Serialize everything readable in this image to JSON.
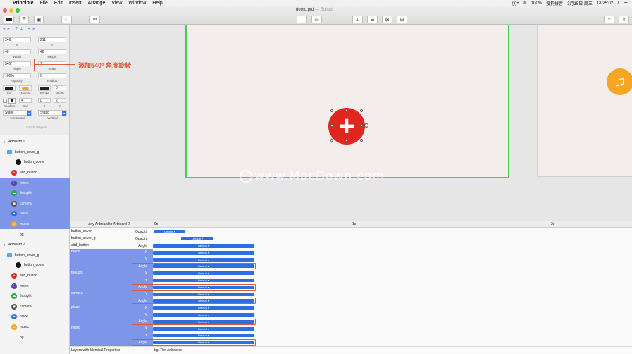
{
  "menubar": {
    "apple": "",
    "app_name": "Principle",
    "menus": [
      "File",
      "Edit",
      "Insert",
      "Arrange",
      "View",
      "Window",
      "Help"
    ],
    "status": {
      "battery": "100%",
      "input_method": "搜狗拼音",
      "date": "3月15日 周三",
      "time": "18:25:02",
      "extra": "gg+"
    }
  },
  "window": {
    "title": "demo.prd",
    "edited": "— Edited"
  },
  "toolbar": {
    "text_tool": "T"
  },
  "inspector": {
    "x": "246",
    "y": "211",
    "x_label": "X",
    "y_label": "Y",
    "width": "48",
    "height": "48",
    "width_label": "Width",
    "height_label": "Height",
    "angle": "540°",
    "scale": "1",
    "angle_label": "Angle",
    "scale_label": "Scale",
    "opacity": "100%",
    "radius": "0",
    "opacity_label": "Opacity",
    "radius_label": "Radius",
    "fill_label": "Fill",
    "media_label": "Media",
    "stroke_label": "Stroke",
    "stroke_width": "0",
    "stroke_width_label": "Width",
    "shadow_label": "Shadow",
    "blur": "4",
    "blur_label": "Blur",
    "shadow_x": "0",
    "shadow_y": "2",
    "shadow_x_label": "X",
    "shadow_y_label": "Y",
    "horizontal": "Static",
    "vertical": "Static",
    "horizontal_label": "Horizontal",
    "vertical_label": "Vertical",
    "clip_sublayers": "Clip Sublayers"
  },
  "annotation": {
    "text": "添加540° 角度旋转"
  },
  "layers": [
    {
      "label": "Artboard 1",
      "indent": 0,
      "icon": "disclosure",
      "hl": false
    },
    {
      "label": "button_cover_g",
      "indent": 1,
      "icon": "folder",
      "hl": false
    },
    {
      "label": "button_cover",
      "indent": 3,
      "icon": "black",
      "hl": false
    },
    {
      "label": "add_button",
      "indent": 2,
      "icon": "red",
      "hl": false
    },
    {
      "label": "moon",
      "indent": 2,
      "icon": "purple",
      "hl": true
    },
    {
      "label": "thought",
      "indent": 2,
      "icon": "green",
      "hl": true
    },
    {
      "label": "camera",
      "indent": 2,
      "icon": "gray",
      "hl": true
    },
    {
      "label": "place",
      "indent": 2,
      "icon": "blue",
      "hl": true
    },
    {
      "label": "music",
      "indent": 2,
      "icon": "orange",
      "hl": true
    },
    {
      "label": "bg",
      "indent": 2,
      "icon": "none",
      "hl": false
    },
    {
      "label": "Artboard 2",
      "indent": 0,
      "icon": "disclosure",
      "hl": false
    },
    {
      "label": "button_cover_g",
      "indent": 1,
      "icon": "folder",
      "hl": false
    },
    {
      "label": "button_cover",
      "indent": 3,
      "icon": "black",
      "hl": false
    },
    {
      "label": "add_button",
      "indent": 2,
      "icon": "red",
      "hl": false
    },
    {
      "label": "moon",
      "indent": 2,
      "icon": "purple",
      "hl": false
    },
    {
      "label": "thought",
      "indent": 2,
      "icon": "green",
      "hl": false
    },
    {
      "label": "camera",
      "indent": 2,
      "icon": "gray",
      "hl": false
    },
    {
      "label": "place",
      "indent": 2,
      "icon": "blue",
      "hl": false
    },
    {
      "label": "music",
      "indent": 2,
      "icon": "orange",
      "hl": false
    },
    {
      "label": "bg",
      "indent": 2,
      "icon": "none",
      "hl": false
    }
  ],
  "canvas": {
    "add_glyph": "+",
    "music_glyph": "♫",
    "watermark": "www.MacDown.com"
  },
  "timeline": {
    "transition": "Any Artboard to Artboard 2",
    "ticks": [
      "0s",
      "1s",
      "2s"
    ],
    "default_label": "Default ▾",
    "footer_label": "Layers with Identical Properties",
    "footer_value": "bg, The Artboards",
    "rows": [
      {
        "layer": "button_cover",
        "prop": "Opacity"
      },
      {
        "layer": "button_cover_g",
        "prop": "Opacity"
      },
      {
        "layer": "add_button",
        "prop": "Angle"
      },
      {
        "layer": "moon",
        "prop": "X"
      },
      {
        "layer": "",
        "prop": "Y"
      },
      {
        "layer": "",
        "prop": "Angle"
      },
      {
        "layer": "thought",
        "prop": "X"
      },
      {
        "layer": "",
        "prop": "Y"
      },
      {
        "layer": "",
        "prop": "Angle"
      },
      {
        "layer": "camera",
        "prop": "Y"
      },
      {
        "layer": "",
        "prop": "Angle"
      },
      {
        "layer": "place",
        "prop": "X"
      },
      {
        "layer": "",
        "prop": "Y"
      },
      {
        "layer": "",
        "prop": "Angle"
      },
      {
        "layer": "music",
        "prop": "X"
      },
      {
        "layer": "",
        "prop": "Y"
      },
      {
        "layer": "",
        "prop": "Angle"
      }
    ]
  },
  "colors": {
    "accent_blue": "#2c6fe0",
    "selection": "#7d96e8",
    "annotation": "#e05a3a",
    "artboard_border": "#45d045",
    "add_button": "#e0261f",
    "music_button": "#f6a623"
  }
}
